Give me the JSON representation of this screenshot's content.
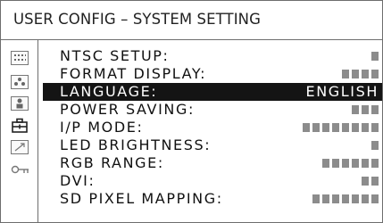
{
  "header": {
    "title": "USER CONFIG – SYSTEM SETTING"
  },
  "sidebar": {
    "icons": [
      "grid-dots-icon",
      "palette-dots-icon",
      "person-icon",
      "toolbox-icon",
      "pen-icon",
      "key-icon"
    ]
  },
  "menu": {
    "selected_index": 2,
    "items": [
      {
        "label": "NTSC SETUP:",
        "bars": 1
      },
      {
        "label": "FORMAT DISPLAY:",
        "bars": 4
      },
      {
        "label": "LANGUAGE:",
        "value": "ENGLISH"
      },
      {
        "label": "POWER SAVING:",
        "bars": 3
      },
      {
        "label": "I/P MODE:",
        "bars": 8
      },
      {
        "label": "LED BRIGHTNESS:",
        "bars": 1
      },
      {
        "label": "RGB RANGE:",
        "bars": 6
      },
      {
        "label": "DVI:",
        "bars": 2
      },
      {
        "label": "SD PIXEL MAPPING:",
        "bars": 7
      }
    ]
  },
  "colors": {
    "selection": "#141414",
    "bar": "#8c8c8c",
    "border": "#6e6e6e"
  }
}
